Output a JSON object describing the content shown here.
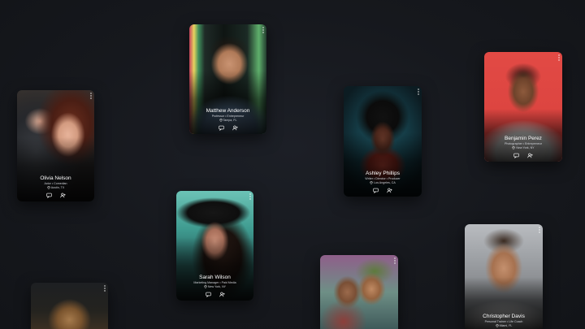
{
  "profiles": [
    {
      "name": "Matthew Anderson",
      "role": "Professor • Entrepreneur",
      "location": "Tampa, FL"
    },
    {
      "name": "Olivia Nelson",
      "role": "Actor • Comedian",
      "location": "Austin, TX"
    },
    {
      "name": "Ashley Phillips",
      "role": "Writer • Director • Producer",
      "location": "Los Angeles, CA"
    },
    {
      "name": "Benjamin Perez",
      "role": "Photographer • Entrepreneur",
      "location": "New York, NY"
    },
    {
      "name": "Sarah Wilson",
      "role": "Marketing Manager • Paid Media",
      "location": "New York, NY"
    },
    {
      "name": "Christopher Davis",
      "role": "Personal Trainer • Life Coach",
      "location": "Miami, FL"
    }
  ],
  "colors": {
    "background": "#16181d",
    "text_secondary": "#cfd2d8"
  },
  "icons": {
    "message": "message-icon",
    "follow": "add-user-icon",
    "more": "more-vertical-icon",
    "location": "location-pin-icon"
  }
}
